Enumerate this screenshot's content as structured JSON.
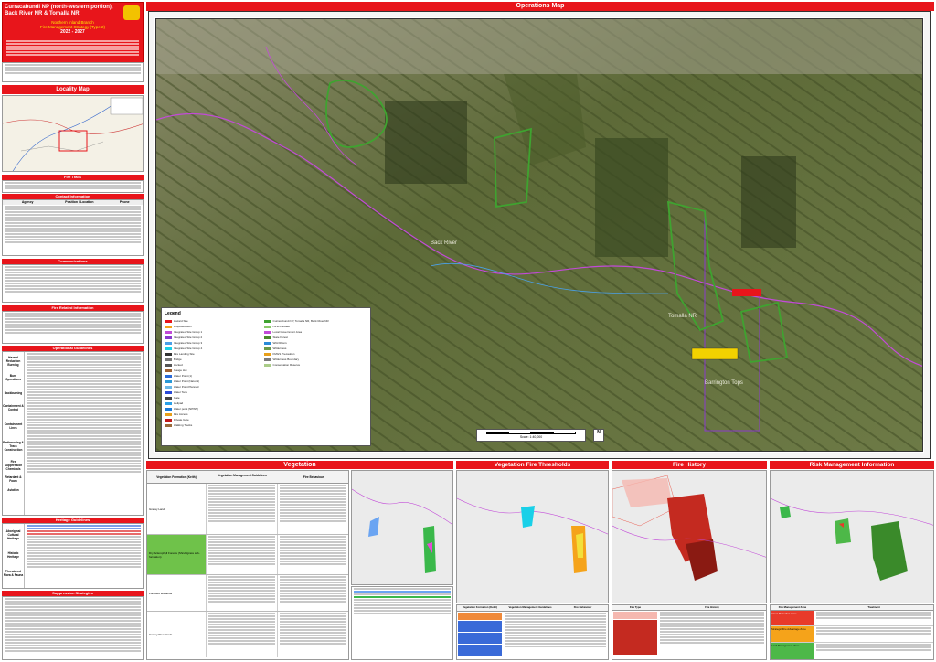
{
  "header": {
    "title": "Curracabundi NP (north-western portion), Back River NR & Tomalla NR",
    "subtitle1": "Northern Inland Branch",
    "subtitle2": "Fire Management Strategy (Type 2)",
    "subtitle3": "2022 - 2027"
  },
  "sections": {
    "locality_map": "Locality Map",
    "operations_map": "Operations Map",
    "vegetation": "Vegetation",
    "vegetation_fire_thresholds": "Vegetation Fire Thresholds",
    "fire_history": "Fire History",
    "risk_management": "Risk Management Information"
  },
  "left_panel": {
    "table_heads": [
      "Fire Trails",
      "Contact Information",
      "Communications",
      "Fire Related Information",
      "Operational Guidelines",
      "Heritage Guidelines",
      "Suppression Strategies"
    ],
    "agencies": [
      "Agency",
      "Position / Location",
      "Phone"
    ],
    "side_labels": [
      "Hazard Reduction Burning",
      "Burn Operations",
      "Backburning",
      "Containment & Control",
      "Containment Lines",
      "Earthmoving & Track Construction",
      "Fire Suppression Chemicals",
      "Retardant & Foam",
      "Aviation",
      "Aboriginal Cultural Heritage",
      "Historic Heritage",
      "Threatened Flora & Fauna"
    ]
  },
  "map": {
    "legend_title": "Legend",
    "legend_left": [
      "Hazard Site",
      "Proposed Burn",
      "Integrated Site Group 1",
      "Integrated Site Group 2",
      "Integrated Site Group 3",
      "Integrated Site Group 4",
      "Fire Landing Site",
      "Bridge",
      "Locked",
      "Gauge Hut",
      "Water Point (1)",
      "Water Point (Natural)",
      "Water Point Planned",
      "Water Tank",
      "Gate",
      "Helipad",
      "Water point (NPWS)",
      "Fire Access",
      "Private Gate",
      "Walking Tracks"
    ],
    "legend_right": [
      "Curracabundi NP, Tomalla NR, Back River NR",
      "NPWS Estate",
      "Local Government Area",
      "State Forest",
      "Wild Rivers",
      "Wilderness",
      "FMGS Precaution",
      "Wilderness Boundary",
      "Conservation Reserve"
    ],
    "labels": [
      "Back River",
      "Tomalla NR",
      "Barrington Tops"
    ],
    "scale_label": "Scale: 1:40,000",
    "north_label": "N"
  },
  "bottom": {
    "veg_table_heads": [
      "Vegetation Formation (Keith)",
      "Vegetation Management Guidelines",
      "Fire Behaviour"
    ],
    "veg_rows": [
      "Grassy Land",
      "Dry Sclerophyll Forests (Shrub/grass sub-formation)",
      "Forested Wetlands",
      "Grassy Woodlands"
    ],
    "threshold_heads": [
      "Vegetation Formation (Keith)",
      "Vegetation Management Guidelines",
      "Fire Behaviour"
    ],
    "fire_history_heads": [
      "Fire Type",
      "Fire History"
    ],
    "risk_heads": [
      "Fire Management Zone",
      "Treatment"
    ],
    "risk_zones": [
      "Asset Protection Zone",
      "Strategic Fire Advantage Zone",
      "Land Management Zone"
    ]
  },
  "colors": {
    "accent_red": "#e8151b",
    "header_yellow": "#ffea00",
    "map_dark": "#4e5a2e",
    "zone_red": "#e83a2a",
    "zone_orange": "#f5a31a",
    "zone_green": "#4db848"
  }
}
